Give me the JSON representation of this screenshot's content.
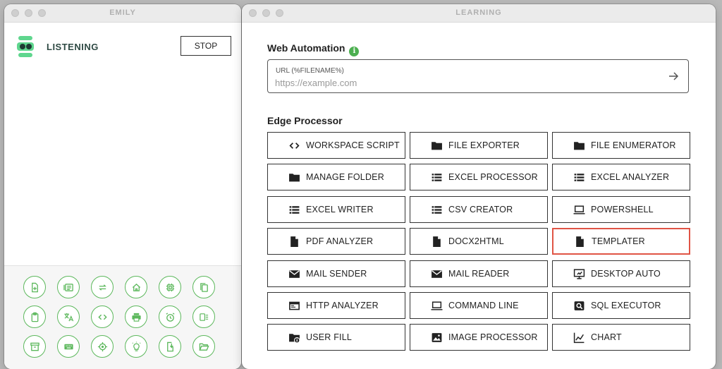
{
  "left_window": {
    "title": "EMILY",
    "status": "LISTENING",
    "stop_label": "STOP",
    "accent": "#5fd68e",
    "tool_accent": "#5cb85c",
    "tools": [
      [
        "file-add-icon",
        "list-icon",
        "repeat-icon",
        "home-icon",
        "cpu-icon",
        "copy-icon"
      ],
      [
        "clipboard-icon",
        "translate-icon",
        "code-icon",
        "print-icon",
        "alarm-icon",
        "document-list-icon"
      ],
      [
        "archive-icon",
        "keyboard-icon",
        "crosshair-icon",
        "lightbulb-icon",
        "file-export-icon",
        "folder-open-icon"
      ]
    ]
  },
  "right_window": {
    "title": "LEARNING",
    "web_automation": {
      "title": "Web Automation",
      "info": "i",
      "url_label": "URL (%FILENAME%)",
      "url_placeholder": "https://example.com",
      "url_value": ""
    },
    "edge_processor": {
      "title": "Edge Processor",
      "selected_border": "#e05445",
      "buttons": [
        {
          "label": "WORKSPACE SCRIPT",
          "icon": "code-icon"
        },
        {
          "label": "FILE EXPORTER",
          "icon": "folder-icon"
        },
        {
          "label": "FILE ENUMERATOR",
          "icon": "folder-icon"
        },
        {
          "label": "MANAGE FOLDER",
          "icon": "folder-icon"
        },
        {
          "label": "EXCEL PROCESSOR",
          "icon": "list-icon"
        },
        {
          "label": "EXCEL ANALYZER",
          "icon": "list-icon"
        },
        {
          "label": "EXCEL WRITER",
          "icon": "list-icon"
        },
        {
          "label": "CSV CREATOR",
          "icon": "list-icon"
        },
        {
          "label": "POWERSHELL",
          "icon": "laptop-icon"
        },
        {
          "label": "PDF ANALYZER",
          "icon": "document-icon"
        },
        {
          "label": "DOCX2HTML",
          "icon": "document-icon"
        },
        {
          "label": "TEMPLATER",
          "icon": "document-icon",
          "selected": true
        },
        {
          "label": "MAIL SENDER",
          "icon": "mail-icon"
        },
        {
          "label": "MAIL READER",
          "icon": "mail-icon"
        },
        {
          "label": "DESKTOP AUTO",
          "icon": "monitor-icon"
        },
        {
          "label": "HTTP ANALYZER",
          "icon": "browser-icon"
        },
        {
          "label": "COMMAND LINE",
          "icon": "laptop-icon"
        },
        {
          "label": "SQL EXECUTOR",
          "icon": "search-box-icon"
        },
        {
          "label": "USER FILL",
          "icon": "folder-info-icon"
        },
        {
          "label": "IMAGE PROCESSOR",
          "icon": "image-icon"
        },
        {
          "label": "CHART",
          "icon": "chart-icon"
        }
      ]
    }
  }
}
